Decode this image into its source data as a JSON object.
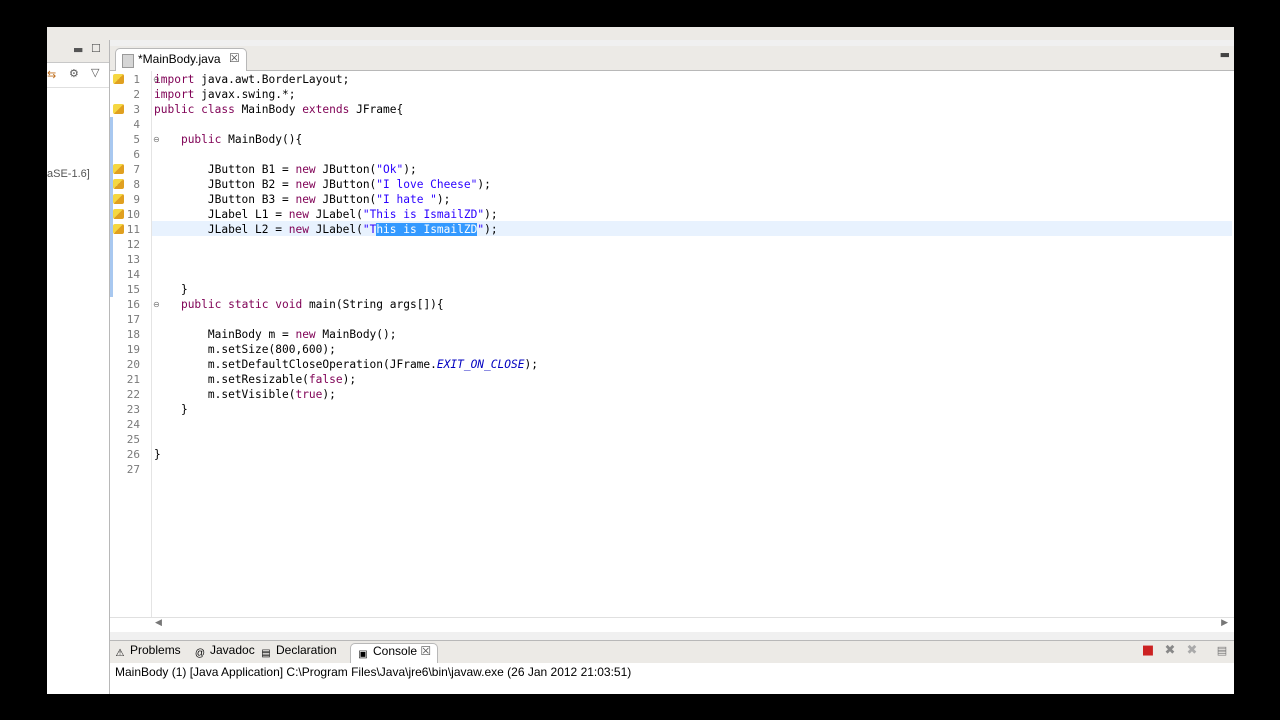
{
  "editor": {
    "tab_label": "*MainBody.java",
    "close_glyph": "☒",
    "lines": [
      {
        "n": "1",
        "tokens": [
          {
            "t": "import",
            "c": "kw"
          },
          {
            "t": " java.awt.BorderLayout;",
            "c": ""
          }
        ]
      },
      {
        "n": "2",
        "tokens": [
          {
            "t": "import",
            "c": "kw"
          },
          {
            "t": " javax.swing.*;",
            "c": ""
          }
        ]
      },
      {
        "n": "3",
        "tokens": [
          {
            "t": "public class",
            "c": "kw"
          },
          {
            "t": " MainBody ",
            "c": ""
          },
          {
            "t": "extends",
            "c": "kw"
          },
          {
            "t": " JFrame{",
            "c": ""
          }
        ]
      },
      {
        "n": "4",
        "tokens": []
      },
      {
        "n": "5",
        "tokens": [
          {
            "t": "    ",
            "c": ""
          },
          {
            "t": "public",
            "c": "kw"
          },
          {
            "t": " MainBody(){",
            "c": ""
          }
        ]
      },
      {
        "n": "6",
        "tokens": []
      },
      {
        "n": "7",
        "tokens": [
          {
            "t": "        JButton B1 = ",
            "c": ""
          },
          {
            "t": "new",
            "c": "kw"
          },
          {
            "t": " JButton(",
            "c": ""
          },
          {
            "t": "\"Ok\"",
            "c": "str"
          },
          {
            "t": ");",
            "c": ""
          }
        ]
      },
      {
        "n": "8",
        "tokens": [
          {
            "t": "        JButton B2 = ",
            "c": ""
          },
          {
            "t": "new",
            "c": "kw"
          },
          {
            "t": " JButton(",
            "c": ""
          },
          {
            "t": "\"I love Cheese\"",
            "c": "str"
          },
          {
            "t": ");",
            "c": ""
          }
        ]
      },
      {
        "n": "9",
        "tokens": [
          {
            "t": "        JButton B3 = ",
            "c": ""
          },
          {
            "t": "new",
            "c": "kw"
          },
          {
            "t": " JButton(",
            "c": ""
          },
          {
            "t": "\"I hate \"",
            "c": "str"
          },
          {
            "t": ");",
            "c": ""
          }
        ]
      },
      {
        "n": "10",
        "tokens": [
          {
            "t": "        JLabel L1 = ",
            "c": ""
          },
          {
            "t": "new",
            "c": "kw"
          },
          {
            "t": " JLabel(",
            "c": ""
          },
          {
            "t": "\"This is IsmailZD\"",
            "c": "str"
          },
          {
            "t": ");",
            "c": ""
          }
        ]
      },
      {
        "n": "11",
        "tokens": [
          {
            "t": "        JLabel L2 = ",
            "c": ""
          },
          {
            "t": "new",
            "c": "kw"
          },
          {
            "t": " JLabel(",
            "c": ""
          },
          {
            "t": "\"T",
            "c": "str"
          },
          {
            "t": "his is IsmailZD",
            "c": "sel"
          },
          {
            "t": "\"",
            "c": "str"
          },
          {
            "t": ");",
            "c": ""
          }
        ]
      },
      {
        "n": "12",
        "tokens": []
      },
      {
        "n": "13",
        "tokens": []
      },
      {
        "n": "14",
        "tokens": []
      },
      {
        "n": "15",
        "tokens": [
          {
            "t": "    }",
            "c": ""
          }
        ]
      },
      {
        "n": "16",
        "tokens": [
          {
            "t": "    ",
            "c": ""
          },
          {
            "t": "public static void",
            "c": "kw"
          },
          {
            "t": " main(String args[]){",
            "c": ""
          }
        ]
      },
      {
        "n": "17",
        "tokens": []
      },
      {
        "n": "18",
        "tokens": [
          {
            "t": "        MainBody m = ",
            "c": ""
          },
          {
            "t": "new",
            "c": "kw"
          },
          {
            "t": " MainBody();",
            "c": ""
          }
        ]
      },
      {
        "n": "19",
        "tokens": [
          {
            "t": "        m.setSize(800,600);",
            "c": ""
          }
        ]
      },
      {
        "n": "20",
        "tokens": [
          {
            "t": "        m.setDefaultCloseOperation(JFrame.",
            "c": ""
          },
          {
            "t": "EXIT_ON_CLOSE",
            "c": "ital"
          },
          {
            "t": ");",
            "c": ""
          }
        ]
      },
      {
        "n": "21",
        "tokens": [
          {
            "t": "        m.setResizable(",
            "c": ""
          },
          {
            "t": "false",
            "c": "kw"
          },
          {
            "t": ");",
            "c": ""
          }
        ]
      },
      {
        "n": "22",
        "tokens": [
          {
            "t": "        m.setVisible(",
            "c": ""
          },
          {
            "t": "true",
            "c": "kw"
          },
          {
            "t": ");",
            "c": ""
          }
        ]
      },
      {
        "n": "23",
        "tokens": [
          {
            "t": "    }",
            "c": ""
          }
        ]
      },
      {
        "n": "24",
        "tokens": []
      },
      {
        "n": "25",
        "tokens": []
      },
      {
        "n": "26",
        "tokens": [
          {
            "t": "}",
            "c": ""
          }
        ]
      },
      {
        "n": "27",
        "tokens": []
      }
    ]
  },
  "left_panel": {
    "jre_label": "aSE-1.6]"
  },
  "console": {
    "tabs": [
      {
        "label": "Problems",
        "icon": "problems-icon",
        "glyph": "⚠"
      },
      {
        "label": "Javadoc",
        "icon": "javadoc-icon",
        "glyph": "@"
      },
      {
        "label": "Declaration",
        "icon": "declaration-icon",
        "glyph": "▤"
      },
      {
        "label": "Console",
        "icon": "console-icon",
        "glyph": "▣",
        "active": true
      }
    ],
    "status_line": "MainBody (1) [Java Application] C:\\Program Files\\Java\\jre6\\bin\\javaw.exe (26 Jan 2012 21:03:51)"
  },
  "colors": {
    "keyword": "#7f0055",
    "string": "#2a00ff",
    "selection": "#3399ff",
    "current_line": "#e8f2fe",
    "terminate": "#cc2222"
  }
}
